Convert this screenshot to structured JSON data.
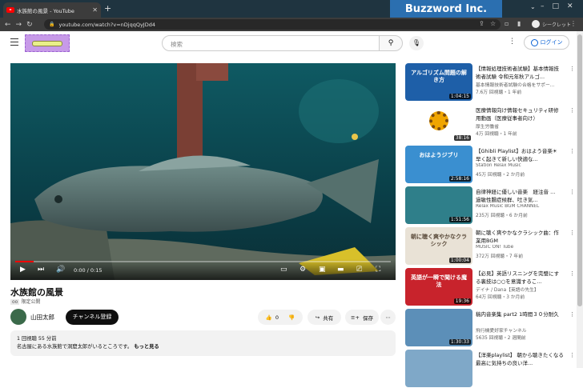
{
  "browser": {
    "tab_title": "水族館の風景 - YouTube",
    "new_tab_symbol": "+",
    "url": "youtube.com/watch?v=nDjqqQyJDd4",
    "incognito_label": "シークレット",
    "brand_overlay": "Buzzword Inc."
  },
  "youtube": {
    "search_placeholder": "検索",
    "login_label": "ログイン"
  },
  "player": {
    "time": "0:00 / 0:15",
    "progress_fraction": 0.05
  },
  "video": {
    "title": "水族館の風景",
    "visibility_badge": "限定公開",
    "visibility_icon": "globe-icon",
    "channel_name": "山田太郎",
    "subscribe_label": "チャンネル登録",
    "like_count": "0",
    "share_label": "共有",
    "save_label": "保存",
    "description_line1": "1 回視聴  55 分前",
    "description_line2": "名古屋にある水族館で洞窟太郎がいるところです。",
    "more_label": "もっと見る"
  },
  "related": [
    {
      "title": "【情報処理技術者試験】基本情報技術者試験 令和元年秋アルゴ...",
      "channel": "基本情報技術者試験の合格をサポー...",
      "meta": "7.6万 回視聴・1 年前",
      "duration": "1:04:15",
      "thumb_text": "アルゴリズム問題の解き方",
      "thumb_color": "#1e5fa8"
    },
    {
      "title": "医療情報向け情報セキュリティ研修用動画（医療従事者向け）",
      "channel": "厚生労働省",
      "meta": "4万 回視聴・1 年前",
      "duration": "38:16",
      "thumb_text": "",
      "thumb_color": "#ffffff"
    },
    {
      "title": "【Ghibli Playlist】おはよう音楽☀ 早く起きて新しい快適な...",
      "channel": "Station Relax Music",
      "meta": "45万 回視聴・2 か月前",
      "duration": "2:58:16",
      "thumb_text": "おはようジブリ",
      "thumb_color": "#3a8fd0"
    },
    {
      "title": "自律神経に優しい音楽　経注音 ...　過敏性腸症候群、吐き気...",
      "channel": "Relax Music BGM CHANNEL",
      "meta": "235万 回視聴・6 か月前",
      "duration": "1:51:56",
      "thumb_text": "",
      "thumb_color": "#2f7f8a"
    },
    {
      "title": "朝に聴く爽やかなクラシック曲：作業用BGM",
      "channel": "MUSIC ON! Tube",
      "meta": "372万 回視聴・7 年前",
      "duration": "1:00:04",
      "thumb_text": "朝に聴く爽やかなクラシック",
      "thumb_color": "#e9e2d6"
    },
    {
      "title": "【必見】英語リスニングを完璧にする裏技は○○を意識するこ...",
      "channel": "デイナ / Dana【英語の先生】",
      "meta": "64万 回視聴・3 か月前",
      "duration": "19:36",
      "thumb_text": "英語が一瞬で聞ける魔法",
      "thumb_color": "#c8232c"
    },
    {
      "title": "稿内音楽集 part2 1時間３０分耐久",
      "channel": "飛行機愛好家チャンネル",
      "meta": "5635 回視聴・2 週間前",
      "duration": "1:30:33",
      "thumb_text": "",
      "thumb_color": "#5c8fb8"
    },
    {
      "title": "【洋楽playlist】 朝から聴きたくなる最高に気持ちの良い洋...",
      "channel": "",
      "meta": "",
      "duration": "",
      "thumb_text": "",
      "thumb_color": "#7fa8c8"
    }
  ],
  "colors": {
    "accent": "#ff0000",
    "link": "#065fd4",
    "brand": "#2b6fb0"
  }
}
